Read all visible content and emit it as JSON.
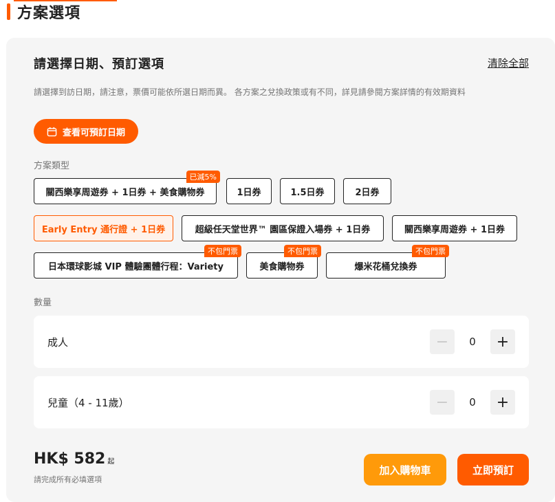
{
  "section": {
    "title": "方案選項"
  },
  "panel": {
    "heading": "請選擇日期、預訂選項",
    "clear_all": "清除全部",
    "notice": "請選擇到訪日期，請注意，票價可能依所選日期而異。 各方案之兌換政策或有不同，詳見請參閱方案詳情的有效期資料",
    "date_button": "查看可預訂日期"
  },
  "plan_type": {
    "label": "方案類型",
    "options": [
      {
        "label": "關西樂享周遊券 + 1日券 + 美食購物券",
        "badge": "已減5%"
      },
      {
        "label": "1日券"
      },
      {
        "label": "1.5日券"
      },
      {
        "label": "2日券"
      },
      {
        "label": "Early Entry 通行證 + 1日券",
        "selected": true
      },
      {
        "label": "超級任天堂世界™ 園區保證入場券 + 1日券"
      },
      {
        "label": "關西樂享周遊券 + 1日券"
      },
      {
        "label": "日本環球影城 VIP 體驗團體行程：Variety",
        "badge": "不包門票"
      },
      {
        "label": "美食購物券",
        "badge": "不包門票"
      },
      {
        "label": "爆米花桶兌換券",
        "badge": "不包門票"
      }
    ]
  },
  "quantity": {
    "label": "數量",
    "rows": [
      {
        "label": "成人",
        "value": "0",
        "minus": "−",
        "plus": "+"
      },
      {
        "label": "兒童（4 - 11歲）",
        "value": "0",
        "minus": "−",
        "plus": "+"
      }
    ]
  },
  "footer": {
    "price": "HK$ 582",
    "price_suffix": "起",
    "price_note": "請完成所有必填選項",
    "cart_button": "加入購物車",
    "book_button": "立即預訂"
  },
  "colors": {
    "accent": "#ff5b00",
    "cart": "#ff9a0a",
    "panel_bg": "#f5f5f5"
  },
  "icons": {
    "date_button": "calendar-icon"
  }
}
